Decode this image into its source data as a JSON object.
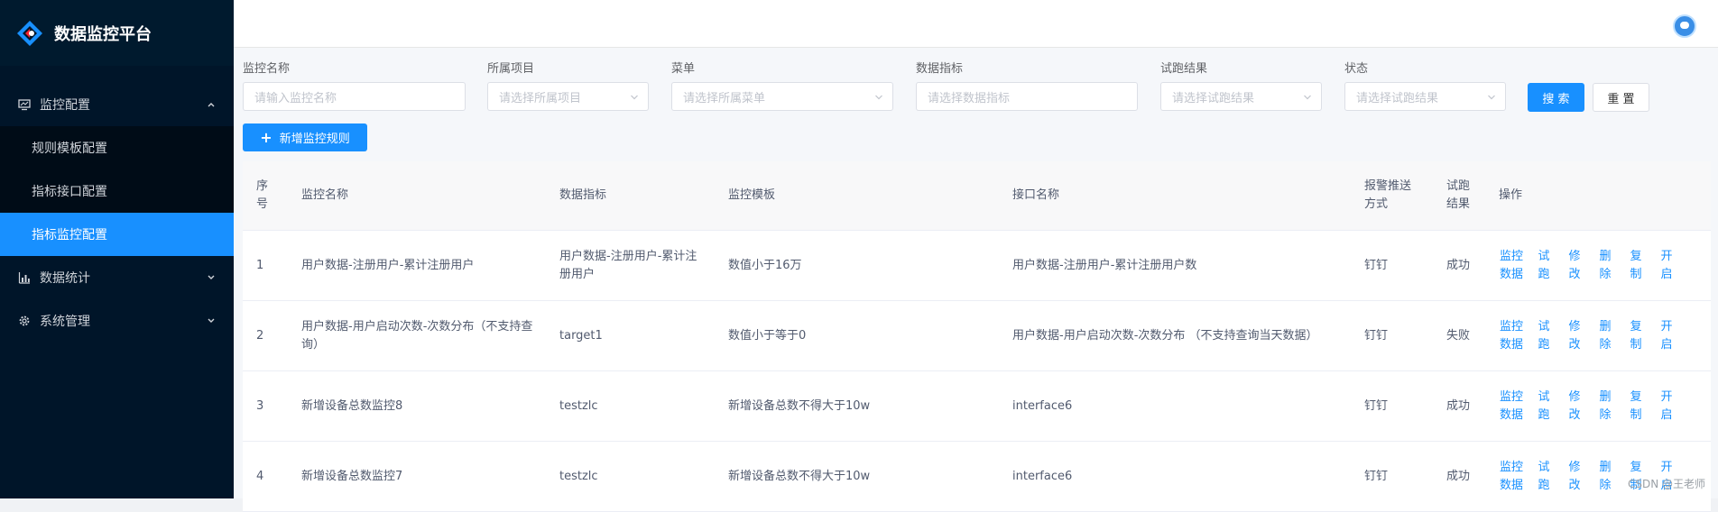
{
  "app": {
    "title": "数据监控平台",
    "accent_color": "#1890ff",
    "sidebar_bg": "#001529"
  },
  "sidebar": {
    "groups": [
      {
        "label": "监控配置",
        "icon": "monitor-icon",
        "expanded": true
      },
      {
        "label": "数据统计",
        "icon": "bar-chart-icon",
        "expanded": false
      },
      {
        "label": "系统管理",
        "icon": "gear-icon",
        "expanded": false
      }
    ],
    "sub_items": [
      {
        "label": "规则模板配置",
        "active": false
      },
      {
        "label": "指标接口配置",
        "active": false
      },
      {
        "label": "指标监控配置",
        "active": true
      }
    ]
  },
  "filters": {
    "name_label": "监控名称",
    "name_placeholder": "请输入监控名称",
    "project_label": "所属项目",
    "project_placeholder": "请选择所属项目",
    "menu_label": "菜单",
    "menu_placeholder": "请选择所属菜单",
    "metric_label": "数据指标",
    "metric_placeholder": "请选择数据指标",
    "trial_label": "试跑结果",
    "trial_placeholder": "请选择试跑结果",
    "status_label": "状态",
    "status_placeholder": "请选择试跑结果",
    "search_button": "搜 索",
    "reset_button": "重 置"
  },
  "actions": {
    "add_label": "新增监控规则"
  },
  "table": {
    "columns": {
      "index": "序号",
      "name": "监控名称",
      "metric": "数据指标",
      "template": "监控模板",
      "api": "接口名称",
      "push": "报警推送方式",
      "result": "试跑结果",
      "ops": "操作"
    },
    "rows": [
      {
        "index": "1",
        "name": "用户数据-注册用户-累计注册用户",
        "metric": "用户数据-注册用户-累计注册用户",
        "template": "数值小于16万",
        "api": "用户数据-注册用户-累计注册用户数",
        "push": "钉钉",
        "result": "成功"
      },
      {
        "index": "2",
        "name": "用户数据-用户启动次数-次数分布（不支持查询）",
        "metric": "target1",
        "template": "数值小于等于0",
        "api": "用户数据-用户启动次数-次数分布 （不支持查询当天数据）",
        "push": "钉钉",
        "result": "失败"
      },
      {
        "index": "3",
        "name": "新增设备总数监控8",
        "metric": "testzlc",
        "template": "新增设备总数不得大于10w",
        "api": "interface6",
        "push": "钉钉",
        "result": "成功"
      },
      {
        "index": "4",
        "name": "新增设备总数监控7",
        "metric": "testzlc",
        "template": "新增设备总数不得大于10w",
        "api": "interface6",
        "push": "钉钉",
        "result": "成功"
      }
    ],
    "row_ops": [
      "监控数据",
      "试跑",
      "修改",
      "删除",
      "复制",
      "开启"
    ]
  },
  "watermark": "CSDN @王老师"
}
